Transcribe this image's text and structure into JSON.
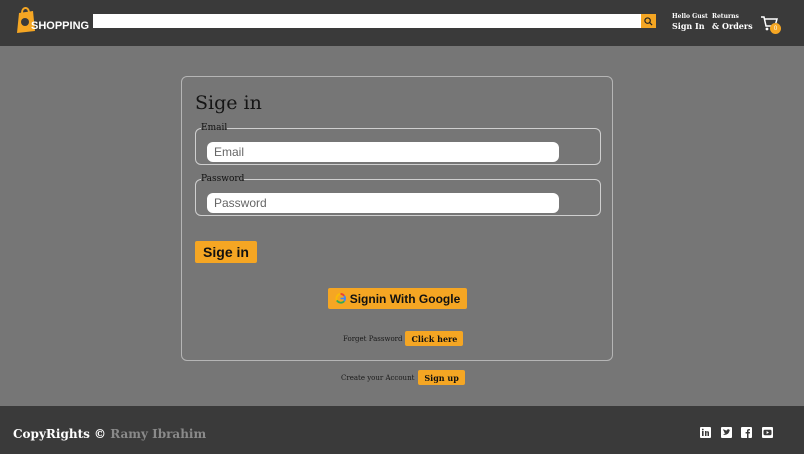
{
  "header": {
    "logo_text": "SHOPPING",
    "search": {
      "placeholder": "",
      "value": ""
    },
    "account": {
      "greeting": "Hello Gust",
      "action": "Sign In"
    },
    "orders": {
      "line1": "Returns",
      "line2": "& Orders"
    },
    "cart_count": "0"
  },
  "signin": {
    "title": "Sige in",
    "email_legend": "Email",
    "email_placeholder": "Email",
    "password_legend": "Password",
    "password_placeholder": "Password",
    "signin_button": "Sige in",
    "google_button": "Signin With Google",
    "forgot_text": "Forget Password",
    "forgot_button": "Click here"
  },
  "create": {
    "text": "Create your Account",
    "button": "Sign up"
  },
  "footer": {
    "copy_prefix": "CopyRights ©",
    "author": "Ramy Ibrahim",
    "social": [
      "linkedin-icon",
      "twitter-icon",
      "facebook-icon",
      "youtube-icon"
    ]
  },
  "colors": {
    "accent": "#f5a623",
    "bar": "#3a3a3a",
    "page": "#767676"
  }
}
